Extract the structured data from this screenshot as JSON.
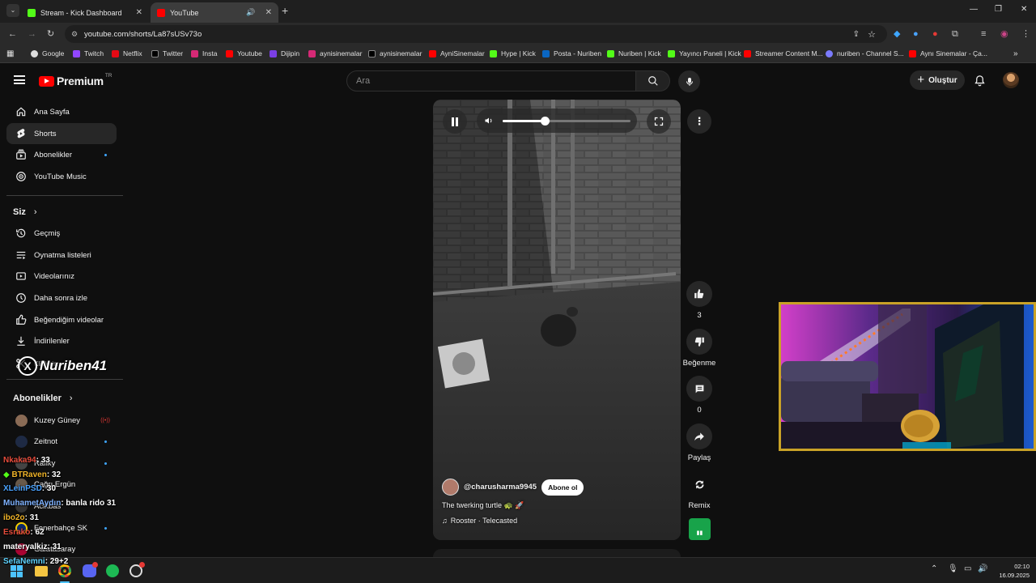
{
  "browser": {
    "tabs": [
      {
        "title": "Stream - Kick Dashboard",
        "active": false
      },
      {
        "title": "YouTube",
        "active": true
      }
    ],
    "url": "youtube.com/shorts/La87sUSv73o",
    "bookmarks": [
      "Google",
      "Twitch",
      "Netflix",
      "Twitter",
      "Insta",
      "Youtube",
      "Dijipin",
      "aynisinemalar",
      "aynisinemalar",
      "AyniSinemalar",
      "Hype | Kick",
      "Posta - Nuriben",
      "Nuriben | Kick",
      "Yayıncı Paneli | Kick",
      "Streamer Content M...",
      "nuriben - Channel S...",
      "Aynı Sinemalar - Ça..."
    ]
  },
  "header": {
    "logo": "Premium",
    "logo_region": "TR",
    "search_placeholder": "Ara",
    "create_label": "Oluştur"
  },
  "sidebar": {
    "main": [
      {
        "label": "Ana Sayfa",
        "icon": "home-icon"
      },
      {
        "label": "Shorts",
        "icon": "shorts-icon"
      },
      {
        "label": "Abonelikler",
        "icon": "subscriptions-icon"
      },
      {
        "label": "YouTube Music",
        "icon": "music-icon"
      }
    ],
    "you_title": "Siz",
    "you": [
      {
        "label": "Geçmiş"
      },
      {
        "label": "Oynatma listeleri"
      },
      {
        "label": "Videolarınız"
      },
      {
        "label": "Daha sonra izle"
      },
      {
        "label": "Beğendiğim videolar"
      },
      {
        "label": "İndirilenler"
      },
      {
        "label": "Kliplerim"
      }
    ],
    "subs_title": "Abonelikler",
    "subs": [
      {
        "label": "Kuzey Güney"
      },
      {
        "label": "Zeitnot"
      },
      {
        "label": "Rafiky"
      },
      {
        "label": "Çağrı Ergün"
      },
      {
        "label": "Acikbas"
      },
      {
        "label": "Fenerbahçe SK"
      },
      {
        "label": "Galatasaray"
      }
    ]
  },
  "watermark": "Nuriben41",
  "short": {
    "channel": "@charusharma9945",
    "subscribe_label": "Abone ol",
    "title": "The twerking turtle 🐢 🚀",
    "music": "Rooster · Telecasted",
    "volume": 0.33
  },
  "actions": {
    "likes": "3",
    "dislike_label": "Beğenme",
    "comments": "0",
    "share_label": "Paylaş",
    "remix_label": "Remix"
  },
  "chat": [
    {
      "user": "Nkaka94",
      "text": ": 33",
      "color": "#e74c3c"
    },
    {
      "user": "BTRaven",
      "text": ": 32",
      "color": "#f0b429"
    },
    {
      "user": "XLeinPSD",
      "text": ": 30",
      "color": "#4aa3ff"
    },
    {
      "user": "MuhametAydın",
      "text": ": banla rido 31",
      "color": "#7fb2ff"
    },
    {
      "user": "ibo2o",
      "text": ": 31",
      "color": "#f0b429"
    },
    {
      "user": "Esrako",
      "text": ": 62",
      "color": "#e74c3c"
    },
    {
      "user": "materyalkiz",
      "text": ": 31",
      "color": "#ffffff"
    },
    {
      "user": "SefaNemni",
      "text": ": 29+2",
      "color": "#5fd3ff"
    }
  ],
  "taskbar": {
    "time": "02:10",
    "date": "16.09.2025"
  },
  "colors": {
    "yt_red": "#ff0000",
    "kick_green": "#53fc18",
    "webcam_border": "#c9a227"
  }
}
